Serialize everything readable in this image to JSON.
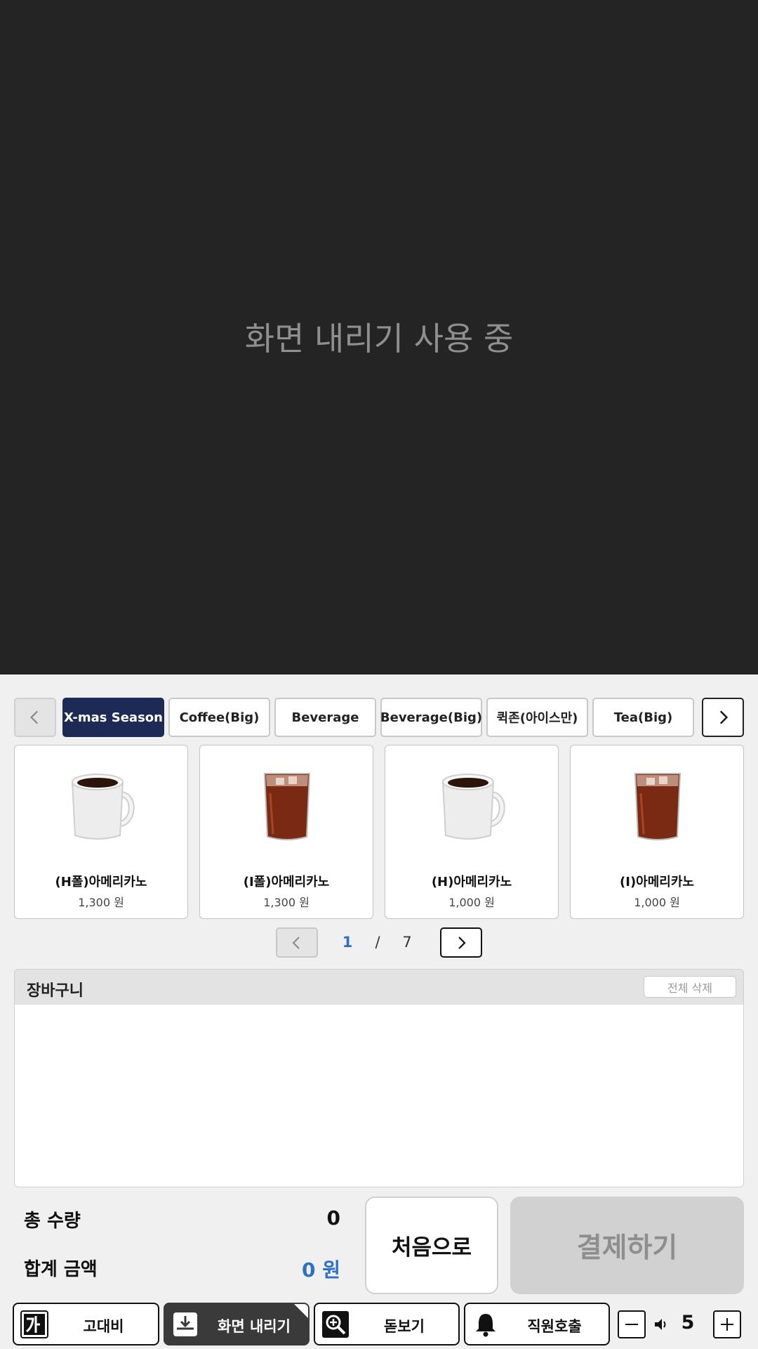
{
  "overlay": {
    "message": "화면 내리기 사용 중"
  },
  "categories": {
    "tabs": [
      {
        "label": "X-mas Season",
        "active": true
      },
      {
        "label": "Coffee(Big)",
        "active": false
      },
      {
        "label": "Beverage",
        "active": false
      },
      {
        "label": "Beverage(Big)",
        "active": false
      },
      {
        "label": "퀵존(아이스만)",
        "active": false
      },
      {
        "label": "Tea(Big)",
        "active": false
      }
    ]
  },
  "products": [
    {
      "name": "(H폴)아메리카노",
      "price": "1,300 원",
      "image": "hot-coffee-mug"
    },
    {
      "name": "(I폴)아메리카노",
      "price": "1,300 원",
      "image": "iced-coffee-glass"
    },
    {
      "name": "(H)아메리카노",
      "price": "1,000 원",
      "image": "hot-coffee-mug"
    },
    {
      "name": "(I)아메리카노",
      "price": "1,000 원",
      "image": "iced-coffee-glass"
    }
  ],
  "pagination": {
    "current": "1",
    "separator": "/",
    "total": "7"
  },
  "cart": {
    "title": "장바구니",
    "clear_label": "전체 삭제",
    "items": []
  },
  "summary": {
    "qty_label": "총 수량",
    "qty_value": "0",
    "amount_label": "합계 금액",
    "amount_value": "0 원"
  },
  "actions": {
    "home_label": "처음으로",
    "pay_label": "결제하기"
  },
  "bottom_bar": {
    "contrast_label": "고대비",
    "lower_screen_label": "화면 내리기",
    "magnifier_label": "돋보기",
    "call_staff_label": "직원호출",
    "volume_value": "5"
  },
  "colors": {
    "accent": "#1d2a56",
    "price_blue": "#2f6fc4",
    "overlay_bg": "#242424"
  }
}
